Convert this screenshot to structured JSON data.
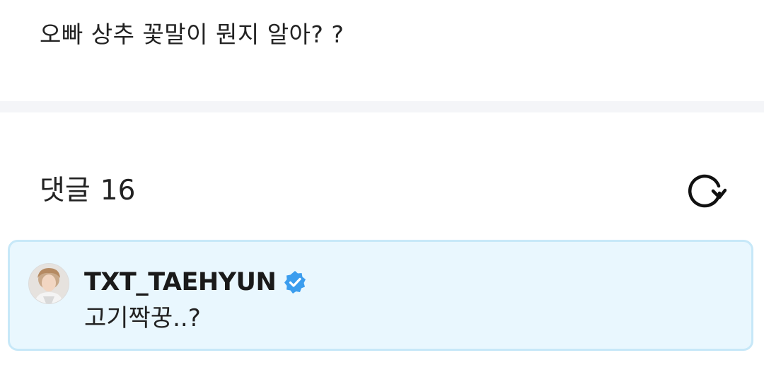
{
  "post": {
    "text": "오빠 상추 꽃말이 뭔지 알아? ?"
  },
  "comments": {
    "title": "댓글",
    "count": "16",
    "refresh_icon": "refresh-icon",
    "items": [
      {
        "author": "TXT_TAEHYUN",
        "verified": true,
        "verified_color": "#3b9dee",
        "text": "고기짝꿍..?"
      }
    ]
  },
  "colors": {
    "divider": "#f4f5f8",
    "card_background": "#e9f7fe",
    "card_border": "#c7e8f8"
  }
}
